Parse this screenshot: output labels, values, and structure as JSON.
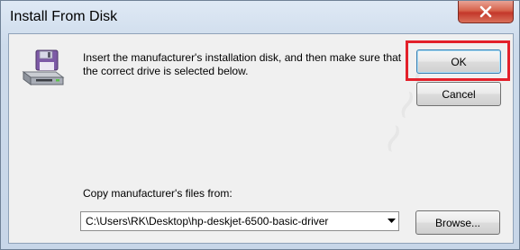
{
  "window": {
    "title": "Install From Disk"
  },
  "dialog": {
    "message": "Insert the manufacturer's installation disk, and then make sure that the correct drive is selected below.",
    "ok_label": "OK",
    "cancel_label": "Cancel",
    "copy_label": "Copy manufacturer's files from:",
    "path_value": "C:\\Users\\RK\\Desktop\\hp-deskjet-6500-basic-driver",
    "browse_label": "Browse..."
  },
  "icons": {
    "close": "close-icon",
    "disk": "disk-drive-icon",
    "dropdown": "chevron-down-icon"
  },
  "colors": {
    "highlight": "#e3202a",
    "close_button": "#c4372a",
    "dialog_background": "#f0f0f0"
  }
}
